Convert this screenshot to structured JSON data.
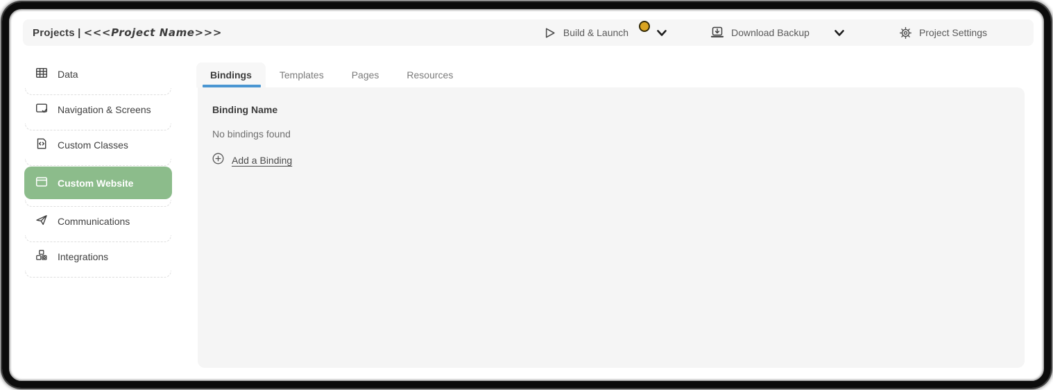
{
  "header": {
    "title_prefix": "Projects |",
    "project_name": "<<<Project Name>>>",
    "actions": {
      "build_launch": "Build & Launch",
      "download_backup": "Download Backup",
      "project_settings": "Project Settings"
    }
  },
  "sidebar": {
    "items": [
      {
        "label": "Data",
        "icon": "table-icon",
        "active": false
      },
      {
        "label": "Navigation & Screens",
        "icon": "screens-icon",
        "active": false
      },
      {
        "label": "Custom Classes",
        "icon": "code-file-icon",
        "active": false
      },
      {
        "label": "Custom Website",
        "icon": "browser-icon",
        "active": true
      },
      {
        "label": "Communications",
        "icon": "send-icon",
        "active": false
      },
      {
        "label": "Integrations",
        "icon": "blocks-icon",
        "active": false
      }
    ]
  },
  "main": {
    "tabs": [
      {
        "label": "Bindings",
        "active": true
      },
      {
        "label": "Templates",
        "active": false
      },
      {
        "label": "Pages",
        "active": false
      },
      {
        "label": "Resources",
        "active": false
      }
    ],
    "content": {
      "column_header": "Binding Name",
      "empty_message": "No bindings found",
      "add_link": "Add a Binding"
    }
  },
  "colors": {
    "accent_green": "#8cbc8b",
    "tab_underline_blue": "#4a96d2",
    "badge_gold": "#d9a421"
  }
}
